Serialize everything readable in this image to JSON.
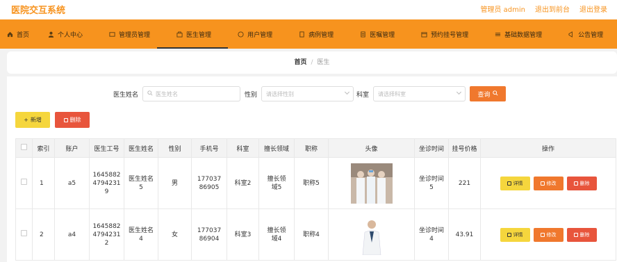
{
  "app": {
    "title": "医院交互系统"
  },
  "header": {
    "user": "管理员 admin",
    "back_to_front": "退出到前台",
    "logout": "退出登录"
  },
  "nav": [
    {
      "label": "首页",
      "icon": "home-icon"
    },
    {
      "label": "个人中心",
      "icon": "user-icon"
    },
    {
      "label": "管理员管理",
      "icon": "admin-icon"
    },
    {
      "label": "医生管理",
      "icon": "doctor-icon",
      "active": true
    },
    {
      "label": "用户管理",
      "icon": "users-icon"
    },
    {
      "label": "病例管理",
      "icon": "case-icon"
    },
    {
      "label": "医嘱管理",
      "icon": "order-icon"
    },
    {
      "label": "预约挂号管理",
      "icon": "appointment-icon"
    },
    {
      "label": "基础数据管理",
      "icon": "data-icon"
    },
    {
      "label": "公告管理",
      "icon": "notice-icon"
    }
  ],
  "breadcrumb": {
    "home": "首页",
    "sep": "/",
    "current": "医生"
  },
  "search": {
    "name_label": "医生姓名",
    "name_placeholder": "医生姓名",
    "gender_label": "性别",
    "gender_placeholder": "请选择性别",
    "dept_label": "科室",
    "dept_placeholder": "请选择科室",
    "query_label": "查询"
  },
  "actions": {
    "add_label": "新增",
    "delete_label": "删除"
  },
  "table": {
    "headers": [
      "索引",
      "账户",
      "医生工号",
      "医生姓名",
      "性别",
      "手机号",
      "科室",
      "擅长领域",
      "职称",
      "头像",
      "坐诊时间",
      "挂号价格",
      "操作"
    ],
    "rows": [
      {
        "index": "1",
        "account": "a5",
        "number": "16458824794231 9",
        "name": "医生姓名5",
        "gender": "男",
        "phone": "17703786905",
        "dept": "科室2",
        "field": "擅长领域5",
        "title": "职称5",
        "time": "坐诊时间5",
        "price": "221"
      },
      {
        "index": "2",
        "account": "a4",
        "number": "16458824794231 2",
        "name": "医生姓名4",
        "gender": "女",
        "phone": "17703786904",
        "dept": "科室3",
        "field": "擅长领域4",
        "title": "职称4",
        "time": "坐诊时间4",
        "price": "43.91"
      }
    ],
    "row_actions": {
      "detail": "详情",
      "edit": "修改",
      "remove": "删除"
    }
  },
  "colors": {
    "accent": "#f7931e",
    "query": "#f0782d",
    "add": "#f5d63d",
    "danger": "#e8553c"
  }
}
